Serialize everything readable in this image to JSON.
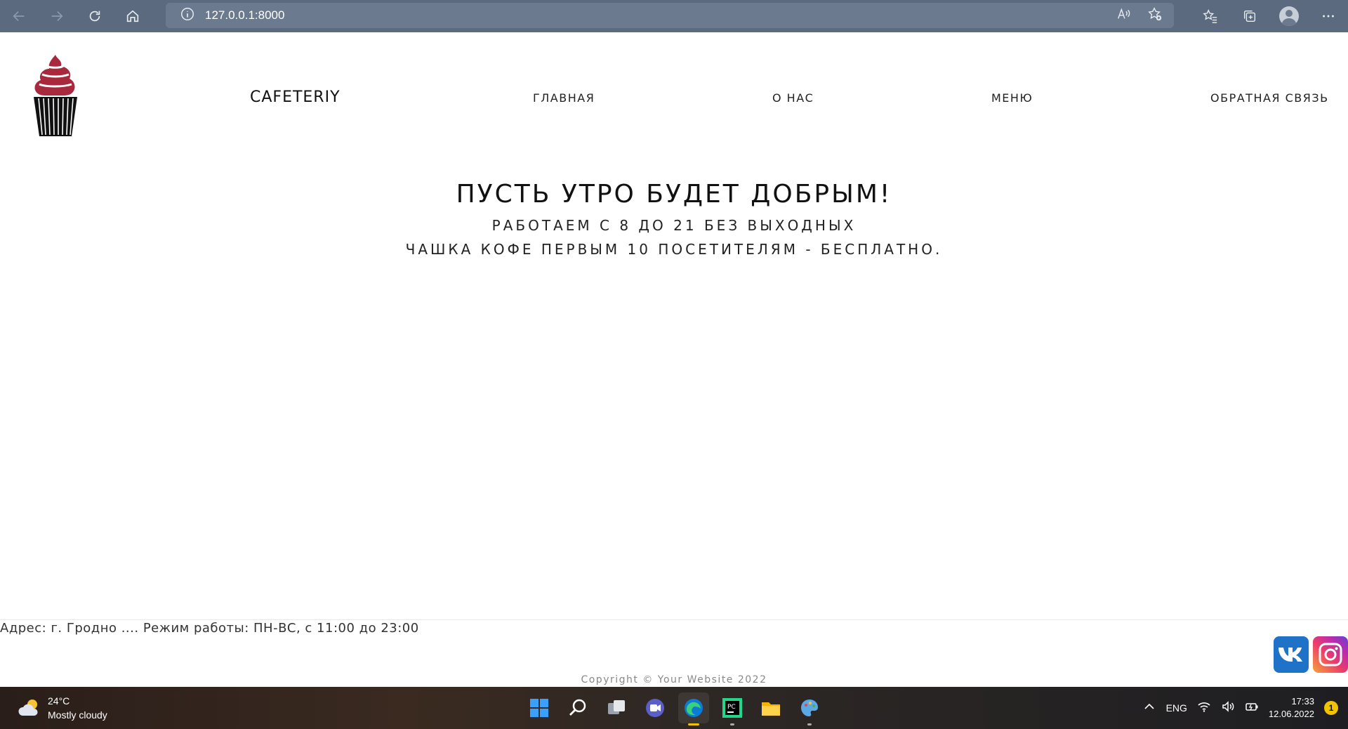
{
  "browser": {
    "url": "127.0.0.1:8000"
  },
  "site": {
    "brand": "CAFETERIY",
    "nav": {
      "home": "ГЛАВНАЯ",
      "about": "О НАС",
      "menu": "МЕНЮ",
      "feedback": "ОБРАТНАЯ СВЯЗЬ"
    },
    "hero": {
      "title": "ПУСТЬ УТРО БУДЕТ ДОБРЫМ!",
      "subtitle": "РАБОТАЕМ С 8 ДО 21 БЕЗ ВЫХОДНЫХ",
      "promo": "ЧАШКА КОФЕ ПЕРВЫМ 10 ПОСЕТИТЕЛЯМ - БЕСПЛАТНО."
    },
    "footer": {
      "address": "Адрес: г. Гродно .... Режим работы: ПН-ВС, с 11:00 до 23:00",
      "copyright": "Copyright © Your Website 2022"
    },
    "social": [
      "vk-icon",
      "instagram-icon"
    ]
  },
  "taskbar": {
    "weather_temp": "24°C",
    "weather_desc": "Mostly cloudy",
    "language": "ENG",
    "time": "17:33",
    "date": "12.06.2022",
    "notifications": "1"
  },
  "colors": {
    "browser_bar": "#5b6a7e",
    "cupcake_cream": "#a8283e",
    "vk": "#1e73c8"
  }
}
